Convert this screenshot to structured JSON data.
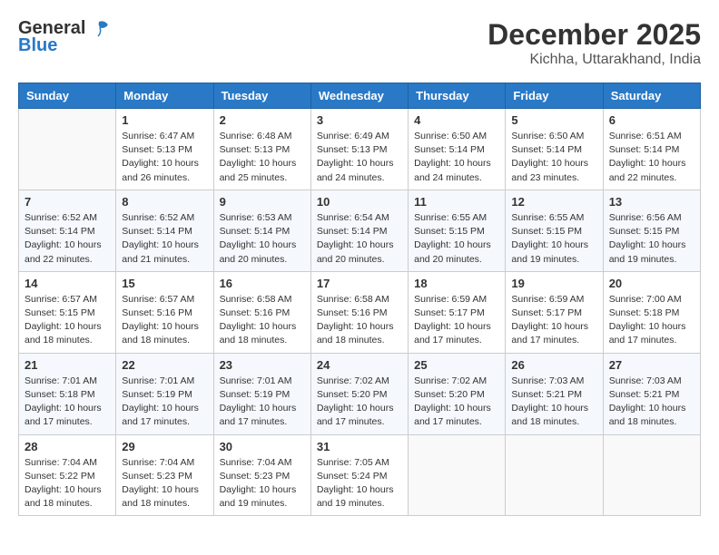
{
  "logo": {
    "general": "General",
    "blue": "Blue"
  },
  "title": {
    "month": "December 2025",
    "location": "Kichha, Uttarakhand, India"
  },
  "headers": [
    "Sunday",
    "Monday",
    "Tuesday",
    "Wednesday",
    "Thursday",
    "Friday",
    "Saturday"
  ],
  "weeks": [
    [
      {
        "day": "",
        "sunrise": "",
        "sunset": "",
        "daylight": ""
      },
      {
        "day": "1",
        "sunrise": "Sunrise: 6:47 AM",
        "sunset": "Sunset: 5:13 PM",
        "daylight": "Daylight: 10 hours and 26 minutes."
      },
      {
        "day": "2",
        "sunrise": "Sunrise: 6:48 AM",
        "sunset": "Sunset: 5:13 PM",
        "daylight": "Daylight: 10 hours and 25 minutes."
      },
      {
        "day": "3",
        "sunrise": "Sunrise: 6:49 AM",
        "sunset": "Sunset: 5:13 PM",
        "daylight": "Daylight: 10 hours and 24 minutes."
      },
      {
        "day": "4",
        "sunrise": "Sunrise: 6:50 AM",
        "sunset": "Sunset: 5:14 PM",
        "daylight": "Daylight: 10 hours and 24 minutes."
      },
      {
        "day": "5",
        "sunrise": "Sunrise: 6:50 AM",
        "sunset": "Sunset: 5:14 PM",
        "daylight": "Daylight: 10 hours and 23 minutes."
      },
      {
        "day": "6",
        "sunrise": "Sunrise: 6:51 AM",
        "sunset": "Sunset: 5:14 PM",
        "daylight": "Daylight: 10 hours and 22 minutes."
      }
    ],
    [
      {
        "day": "7",
        "sunrise": "Sunrise: 6:52 AM",
        "sunset": "Sunset: 5:14 PM",
        "daylight": "Daylight: 10 hours and 22 minutes."
      },
      {
        "day": "8",
        "sunrise": "Sunrise: 6:52 AM",
        "sunset": "Sunset: 5:14 PM",
        "daylight": "Daylight: 10 hours and 21 minutes."
      },
      {
        "day": "9",
        "sunrise": "Sunrise: 6:53 AM",
        "sunset": "Sunset: 5:14 PM",
        "daylight": "Daylight: 10 hours and 20 minutes."
      },
      {
        "day": "10",
        "sunrise": "Sunrise: 6:54 AM",
        "sunset": "Sunset: 5:14 PM",
        "daylight": "Daylight: 10 hours and 20 minutes."
      },
      {
        "day": "11",
        "sunrise": "Sunrise: 6:55 AM",
        "sunset": "Sunset: 5:15 PM",
        "daylight": "Daylight: 10 hours and 20 minutes."
      },
      {
        "day": "12",
        "sunrise": "Sunrise: 6:55 AM",
        "sunset": "Sunset: 5:15 PM",
        "daylight": "Daylight: 10 hours and 19 minutes."
      },
      {
        "day": "13",
        "sunrise": "Sunrise: 6:56 AM",
        "sunset": "Sunset: 5:15 PM",
        "daylight": "Daylight: 10 hours and 19 minutes."
      }
    ],
    [
      {
        "day": "14",
        "sunrise": "Sunrise: 6:57 AM",
        "sunset": "Sunset: 5:15 PM",
        "daylight": "Daylight: 10 hours and 18 minutes."
      },
      {
        "day": "15",
        "sunrise": "Sunrise: 6:57 AM",
        "sunset": "Sunset: 5:16 PM",
        "daylight": "Daylight: 10 hours and 18 minutes."
      },
      {
        "day": "16",
        "sunrise": "Sunrise: 6:58 AM",
        "sunset": "Sunset: 5:16 PM",
        "daylight": "Daylight: 10 hours and 18 minutes."
      },
      {
        "day": "17",
        "sunrise": "Sunrise: 6:58 AM",
        "sunset": "Sunset: 5:16 PM",
        "daylight": "Daylight: 10 hours and 18 minutes."
      },
      {
        "day": "18",
        "sunrise": "Sunrise: 6:59 AM",
        "sunset": "Sunset: 5:17 PM",
        "daylight": "Daylight: 10 hours and 17 minutes."
      },
      {
        "day": "19",
        "sunrise": "Sunrise: 6:59 AM",
        "sunset": "Sunset: 5:17 PM",
        "daylight": "Daylight: 10 hours and 17 minutes."
      },
      {
        "day": "20",
        "sunrise": "Sunrise: 7:00 AM",
        "sunset": "Sunset: 5:18 PM",
        "daylight": "Daylight: 10 hours and 17 minutes."
      }
    ],
    [
      {
        "day": "21",
        "sunrise": "Sunrise: 7:01 AM",
        "sunset": "Sunset: 5:18 PM",
        "daylight": "Daylight: 10 hours and 17 minutes."
      },
      {
        "day": "22",
        "sunrise": "Sunrise: 7:01 AM",
        "sunset": "Sunset: 5:19 PM",
        "daylight": "Daylight: 10 hours and 17 minutes."
      },
      {
        "day": "23",
        "sunrise": "Sunrise: 7:01 AM",
        "sunset": "Sunset: 5:19 PM",
        "daylight": "Daylight: 10 hours and 17 minutes."
      },
      {
        "day": "24",
        "sunrise": "Sunrise: 7:02 AM",
        "sunset": "Sunset: 5:20 PM",
        "daylight": "Daylight: 10 hours and 17 minutes."
      },
      {
        "day": "25",
        "sunrise": "Sunrise: 7:02 AM",
        "sunset": "Sunset: 5:20 PM",
        "daylight": "Daylight: 10 hours and 17 minutes."
      },
      {
        "day": "26",
        "sunrise": "Sunrise: 7:03 AM",
        "sunset": "Sunset: 5:21 PM",
        "daylight": "Daylight: 10 hours and 18 minutes."
      },
      {
        "day": "27",
        "sunrise": "Sunrise: 7:03 AM",
        "sunset": "Sunset: 5:21 PM",
        "daylight": "Daylight: 10 hours and 18 minutes."
      }
    ],
    [
      {
        "day": "28",
        "sunrise": "Sunrise: 7:04 AM",
        "sunset": "Sunset: 5:22 PM",
        "daylight": "Daylight: 10 hours and 18 minutes."
      },
      {
        "day": "29",
        "sunrise": "Sunrise: 7:04 AM",
        "sunset": "Sunset: 5:23 PM",
        "daylight": "Daylight: 10 hours and 18 minutes."
      },
      {
        "day": "30",
        "sunrise": "Sunrise: 7:04 AM",
        "sunset": "Sunset: 5:23 PM",
        "daylight": "Daylight: 10 hours and 19 minutes."
      },
      {
        "day": "31",
        "sunrise": "Sunrise: 7:05 AM",
        "sunset": "Sunset: 5:24 PM",
        "daylight": "Daylight: 10 hours and 19 minutes."
      },
      {
        "day": "",
        "sunrise": "",
        "sunset": "",
        "daylight": ""
      },
      {
        "day": "",
        "sunrise": "",
        "sunset": "",
        "daylight": ""
      },
      {
        "day": "",
        "sunrise": "",
        "sunset": "",
        "daylight": ""
      }
    ]
  ]
}
